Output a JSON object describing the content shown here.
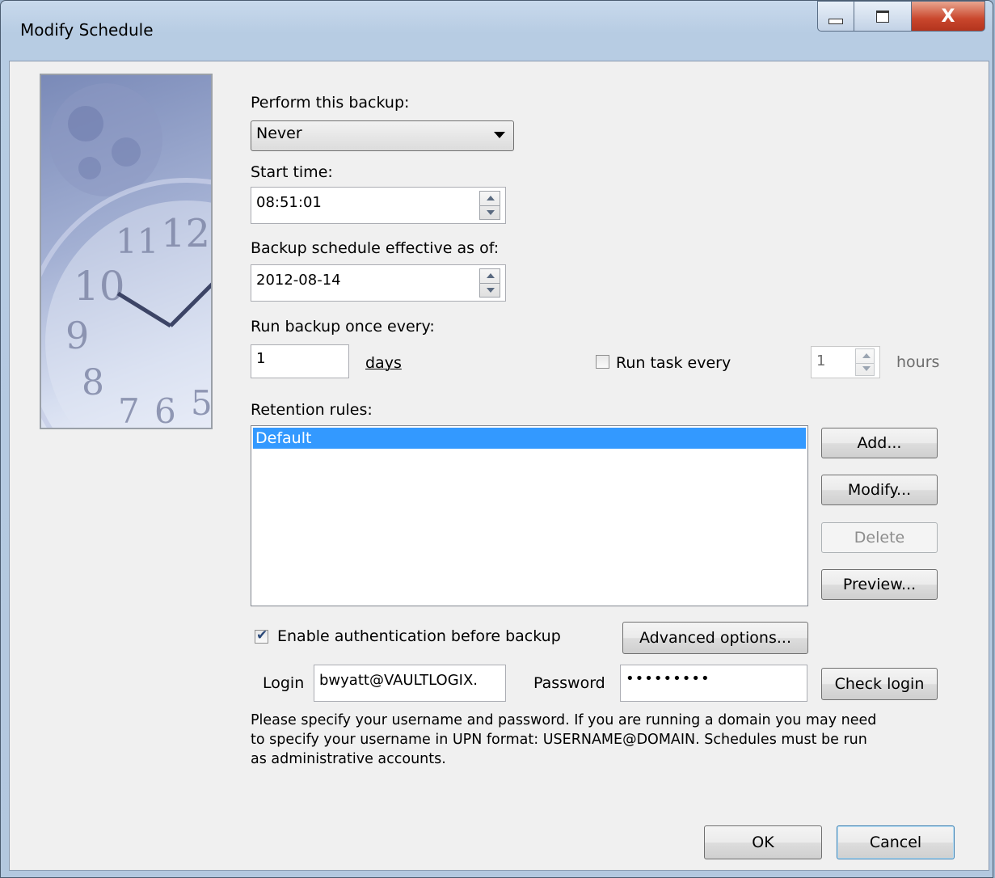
{
  "window": {
    "title": "Modify Schedule",
    "close_glyph": "X"
  },
  "perform": {
    "label": "Perform this backup:",
    "value": "Never"
  },
  "start_time": {
    "label": "Start time:",
    "value": "08:51:01"
  },
  "effective": {
    "label": "Backup schedule effective as of:",
    "value": "2012-08-14"
  },
  "run_every": {
    "label": "Run backup once every:",
    "value": "1",
    "unit": "days"
  },
  "run_task": {
    "label": "Run task every",
    "checked": false,
    "value": "1",
    "unit": "hours"
  },
  "retention": {
    "label": "Retention rules:",
    "items": [
      "Default"
    ]
  },
  "buttons": {
    "add": "Add...",
    "modify": "Modify...",
    "delete": "Delete",
    "preview": "Preview...",
    "advanced": "Advanced options...",
    "check_login": "Check login",
    "ok": "OK",
    "cancel": "Cancel"
  },
  "auth": {
    "label": "Enable authentication before backup",
    "checked": true
  },
  "login": {
    "label": "Login",
    "value": "bwyatt@VAULTLOGIX."
  },
  "password": {
    "label": "Password",
    "value": "•••••••••"
  },
  "help_text": [
    "Please specify your username and password.  If you are running a domain you may need",
    "to specify your username in UPN format: USERNAME@DOMAIN.  Schedules must be run",
    "as administrative accounts."
  ],
  "icons": {
    "minimize": "minimize-icon",
    "maximize": "maximize-icon",
    "close": "close-icon",
    "dropdown": "chevron-down-icon",
    "spin": "spinner-arrows-icon",
    "clock": "clock-illustration"
  }
}
